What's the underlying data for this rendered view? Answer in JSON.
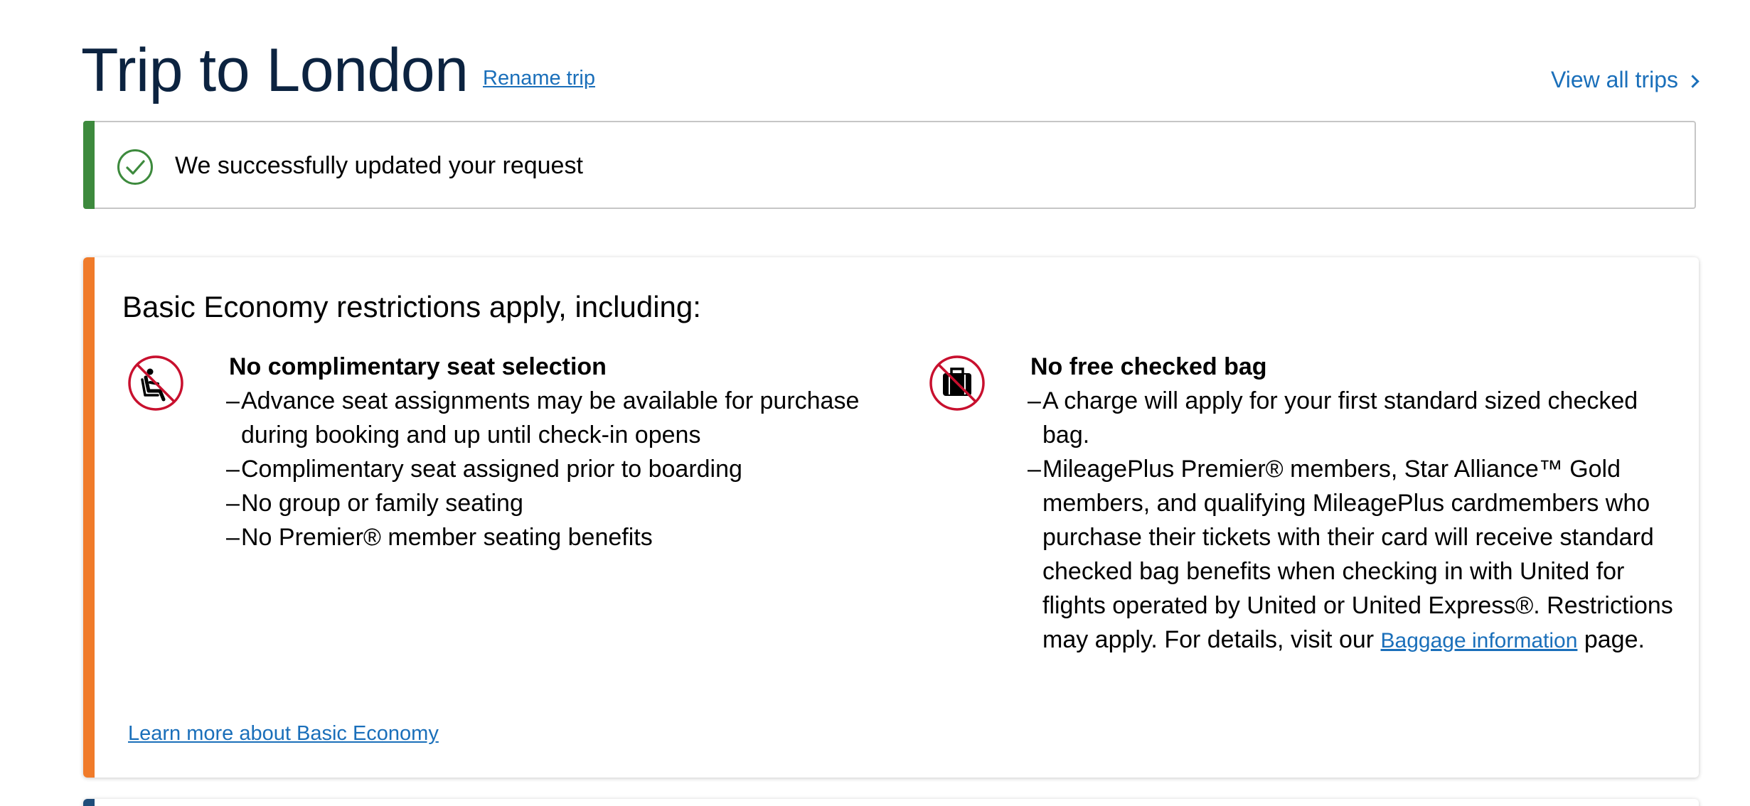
{
  "header": {
    "title": "Trip to London",
    "rename_label": "Rename trip",
    "view_all_label": "View all trips"
  },
  "alert": {
    "message": "We successfully updated your request",
    "icon": "check-circle-icon",
    "accent_color": "#3d8a3d"
  },
  "restrictions": {
    "heading": "Basic Economy restrictions apply, including:",
    "accent_color": "#f07b2a",
    "seat": {
      "icon": "no-seat-selection-icon",
      "title": "No complimentary seat selection",
      "items": [
        "Advance seat assignments may be available for purchase during booking and up until check-in opens",
        "Complimentary seat assigned prior to boarding",
        "No group or family seating",
        "No Premier® member seating benefits"
      ]
    },
    "bag": {
      "icon": "no-checked-bag-icon",
      "title": "No free checked bag",
      "items": [
        "A charge will apply for your first standard sized checked bag."
      ],
      "premier_text": "MileagePlus Premier® members, Star Alliance™ Gold members, and qualifying MileagePlus cardmembers who purchase their tickets with their card will receive standard checked bag benefits when checking in with United for flights operated by United or United Express®. Restrictions may apply. For details, visit our",
      "baggage_link": "Baggage information",
      "premier_suffix": "page."
    },
    "learn_more_label": "Learn more about Basic Economy"
  },
  "colors": {
    "title": "#0c2340",
    "link": "#1a6fba",
    "icon_red": "#c8102e"
  }
}
